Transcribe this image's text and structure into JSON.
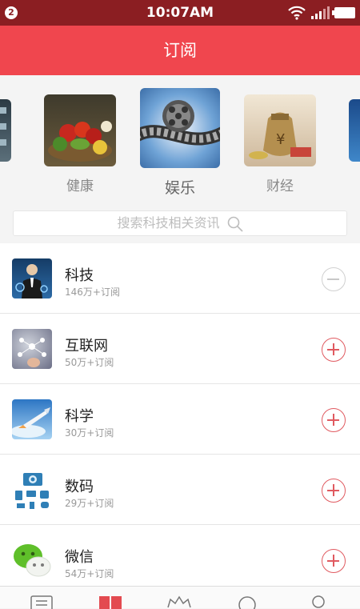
{
  "status_bar": {
    "notification_count": "2",
    "time": "10:07AM"
  },
  "header": {
    "title": "订阅"
  },
  "categories": [
    {
      "label": "",
      "icon": "partial-thumbnail-left"
    },
    {
      "label": "健康",
      "icon": "vegetables-photo"
    },
    {
      "label": "娱乐",
      "icon": "film-reel-photo",
      "selected": true
    },
    {
      "label": "财经",
      "icon": "money-bag-photo"
    },
    {
      "label": "",
      "icon": "partial-thumbnail-right"
    }
  ],
  "search": {
    "placeholder": "搜索科技相关资讯"
  },
  "subscriptions": [
    {
      "name": "科技",
      "subs": "146万+订阅",
      "subscribed": true,
      "icon": "tech-businessman-icon"
    },
    {
      "name": "互联网",
      "subs": "50万+订阅",
      "subscribed": false,
      "icon": "internet-network-icon"
    },
    {
      "name": "科学",
      "subs": "30万+订阅",
      "subscribed": false,
      "icon": "science-rocket-icon"
    },
    {
      "name": "数码",
      "subs": "29万+订阅",
      "subscribed": false,
      "icon": "digital-devices-icon"
    },
    {
      "name": "微信",
      "subs": "54万+订阅",
      "subscribed": false,
      "icon": "wechat-icon"
    }
  ],
  "tabbar": [
    {
      "icon": "news-list-icon",
      "active": false
    },
    {
      "icon": "subscribe-book-icon",
      "active": true
    },
    {
      "icon": "crown-icon",
      "active": false
    },
    {
      "icon": "discover-circle-icon",
      "active": false
    },
    {
      "icon": "profile-person-icon",
      "active": false
    }
  ],
  "colors": {
    "header": "#f0464e",
    "status_bar": "#8b1e22",
    "accent": "#e05a60"
  }
}
